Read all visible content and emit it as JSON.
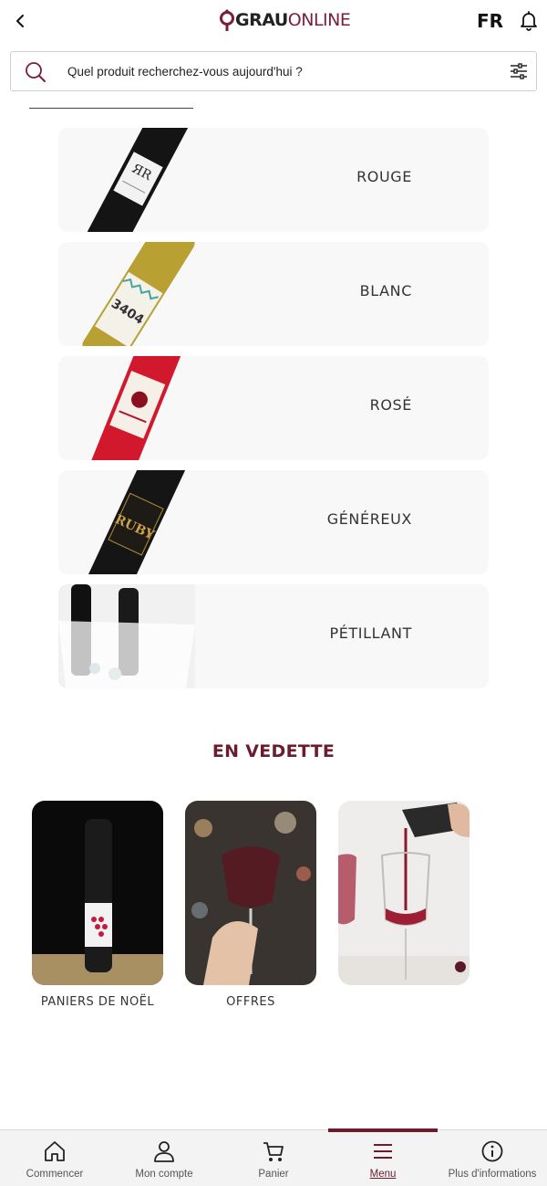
{
  "header": {
    "logo_bold": "GRAU",
    "logo_light": "ONLINE",
    "language": "FR"
  },
  "search": {
    "placeholder": "Quel produit recherchez-vous aujourd'hui ?"
  },
  "categories": [
    {
      "label": "ROUGE"
    },
    {
      "label": "BLANC"
    },
    {
      "label": "ROSÉ"
    },
    {
      "label": "GÉNÉREUX"
    },
    {
      "label": "PÉTILLANT"
    }
  ],
  "featured": {
    "title": "EN VEDETTE",
    "items": [
      {
        "label": "PANIERS DE NOËL"
      },
      {
        "label": "OFFRES"
      },
      {
        "label": ""
      }
    ]
  },
  "bottom_nav": [
    {
      "label": "Commencer",
      "icon": "home-icon"
    },
    {
      "label": "Mon compte",
      "icon": "user-icon"
    },
    {
      "label": "Panier",
      "icon": "cart-icon"
    },
    {
      "label": "Menu",
      "icon": "menu-icon",
      "active": true
    },
    {
      "label": "Plus d'informations",
      "icon": "info-icon"
    }
  ],
  "colors": {
    "brand": "#6b1c2e",
    "card_bg": "#f8f8f8"
  }
}
